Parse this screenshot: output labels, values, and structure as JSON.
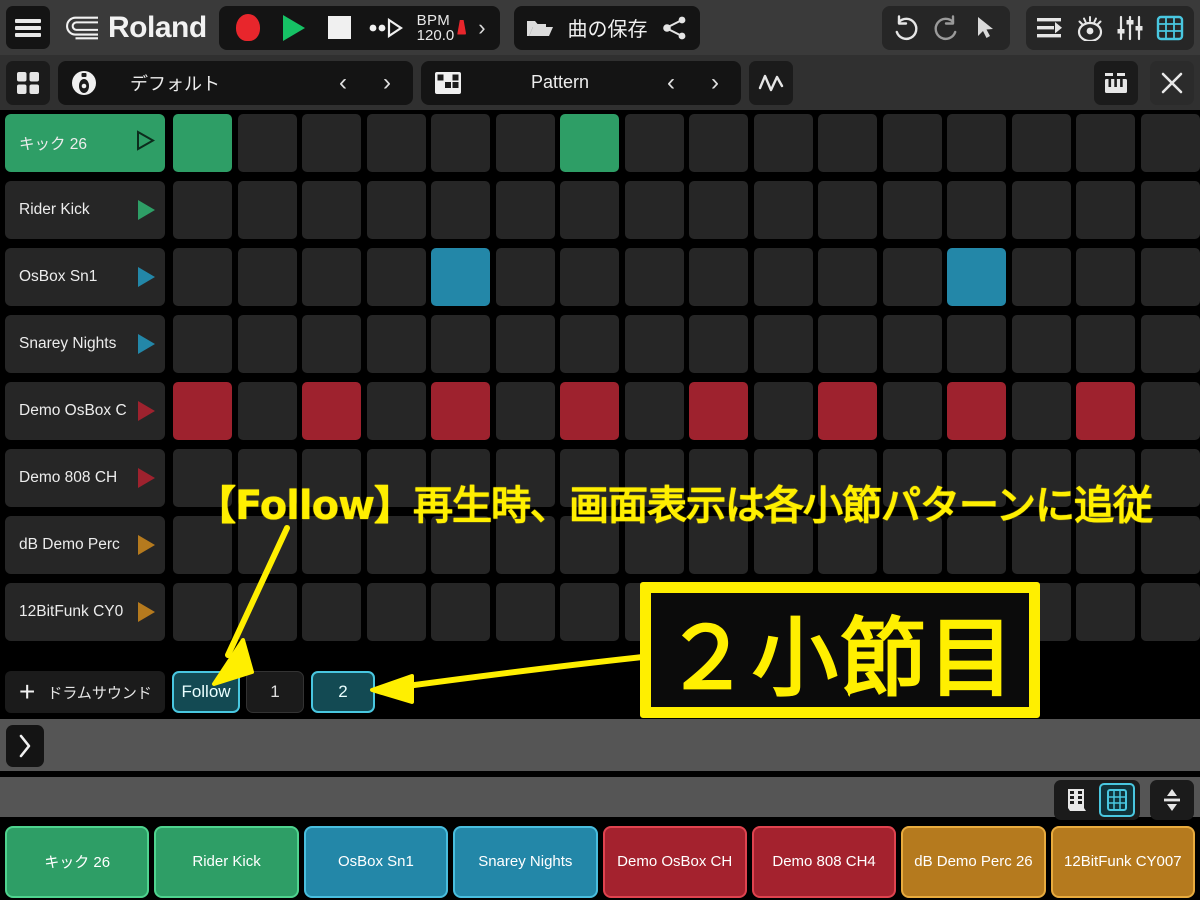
{
  "topbar": {
    "menu_icon": "hamburger-icon",
    "brand": "Roland",
    "transport": {
      "record": "record-button",
      "play": "play-button",
      "stop": "stop-button",
      "step": "step-forward-button",
      "bpm_label": "BPM",
      "bpm_value": "120.0",
      "expand": "›"
    },
    "file": {
      "folder_icon": "folder-open-icon",
      "save_label": "曲の保存",
      "share_icon": "share-icon"
    },
    "right_group1": [
      "undo-icon",
      "redo-icon",
      "pointer-icon"
    ],
    "right_group2": [
      "arrange-icon",
      "eye-icon",
      "mixer-icon",
      "grid-icon"
    ]
  },
  "secondbar": {
    "apps_icon": "apps-grid-icon",
    "kit": {
      "icon": "drum-kit-icon",
      "name": "デフォルト",
      "prev": "‹",
      "next": "›"
    },
    "pattern": {
      "icon": "pattern-icon",
      "name": "Pattern",
      "prev": "‹",
      "next": "›"
    },
    "automation_icon": "automation-icon",
    "keyboard_icon": "keyboard-icon",
    "close_icon": "close-icon"
  },
  "tracks": [
    {
      "name": "キック 26",
      "color": "#2e9e66",
      "active": true,
      "steps": [
        1,
        0,
        0,
        0,
        0,
        0,
        1,
        0,
        0,
        0,
        0,
        0,
        0,
        0,
        0,
        0
      ]
    },
    {
      "name": "Rider Kick",
      "color": "#2e9e66",
      "active": false,
      "steps": [
        0,
        0,
        0,
        0,
        0,
        0,
        0,
        0,
        0,
        0,
        0,
        0,
        0,
        0,
        0,
        0
      ]
    },
    {
      "name": "OsBox Sn1",
      "color": "#2387a8",
      "active": false,
      "steps": [
        0,
        0,
        0,
        0,
        1,
        0,
        0,
        0,
        0,
        0,
        0,
        0,
        1,
        0,
        0,
        0
      ]
    },
    {
      "name": "Snarey Nights",
      "color": "#2387a8",
      "active": false,
      "steps": [
        0,
        0,
        0,
        0,
        0,
        0,
        0,
        0,
        0,
        0,
        0,
        0,
        0,
        0,
        0,
        0
      ]
    },
    {
      "name": "Demo OsBox C",
      "color": "#9e222e",
      "active": false,
      "steps": [
        1,
        0,
        1,
        0,
        1,
        0,
        1,
        0,
        1,
        0,
        1,
        0,
        1,
        0,
        1,
        0
      ]
    },
    {
      "name": "Demo 808 CH",
      "color": "#9e222e",
      "active": false,
      "steps": [
        0,
        0,
        0,
        0,
        0,
        0,
        0,
        0,
        0,
        0,
        0,
        0,
        0,
        0,
        0,
        0
      ]
    },
    {
      "name": "dB Demo Perc",
      "color": "#b57a1e",
      "active": false,
      "steps": [
        0,
        0,
        0,
        0,
        0,
        0,
        0,
        0,
        0,
        0,
        0,
        0,
        0,
        0,
        0,
        0
      ]
    },
    {
      "name": "12BitFunk CY0",
      "color": "#b57a1e",
      "active": false,
      "steps": [
        0,
        0,
        0,
        0,
        0,
        0,
        0,
        0,
        0,
        0,
        0,
        0,
        0,
        0,
        0,
        0
      ]
    }
  ],
  "bottom_controls": {
    "add_label": "ドラムサウンド",
    "add_icon": "plus-icon",
    "follow_label": "Follow",
    "follow_on": true,
    "bars": [
      {
        "label": "1",
        "selected": false
      },
      {
        "label": "2",
        "selected": true
      }
    ]
  },
  "panelA": {
    "expand_icon": "chevron-right-icon"
  },
  "panelB": {
    "icons": [
      {
        "name": "velocity-view-icon",
        "selected": false
      },
      {
        "name": "grid-view-icon",
        "selected": true
      }
    ],
    "resize_icon": "resize-vertical-icon"
  },
  "pads": [
    {
      "label": "キック 26",
      "color": "#2e9e66",
      "border": "#4fd38e"
    },
    {
      "label": "Rider Kick",
      "color": "#2e9e66",
      "border": "#4fd38e"
    },
    {
      "label": "OsBox Sn1",
      "color": "#2387a8",
      "border": "#49bede"
    },
    {
      "label": "Snarey Nights",
      "color": "#2387a8",
      "border": "#49bede"
    },
    {
      "label": "Demo OsBox CH",
      "color": "#a4222e",
      "border": "#e0434f"
    },
    {
      "label": "Demo 808 CH4",
      "color": "#a4222e",
      "border": "#e0434f"
    },
    {
      "label": "dB Demo Perc 26",
      "color": "#b57a1e",
      "border": "#e8ab3e"
    },
    {
      "label": "12BitFunk CY007",
      "color": "#b57a1e",
      "border": "#e8ab3e"
    }
  ],
  "annotations": {
    "accent_color": "#ffef00",
    "line1": "【Follow】再生時、画面表示は各小節パターンに追従",
    "boxed_text": "２小節目"
  }
}
